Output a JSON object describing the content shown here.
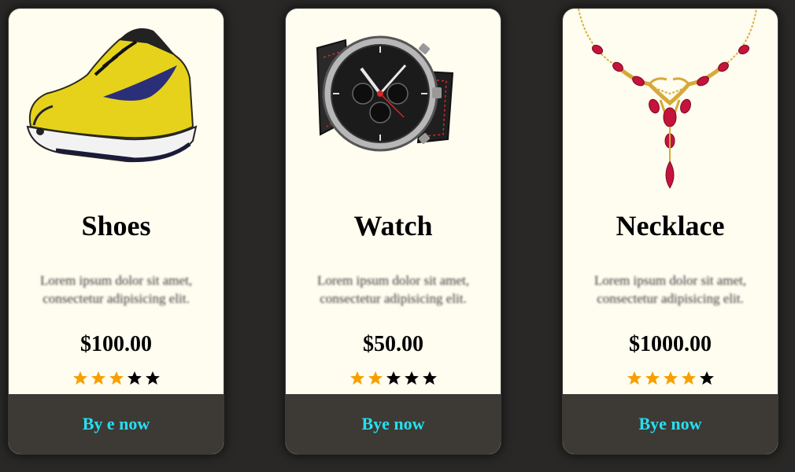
{
  "products": [
    {
      "name": "Shoes",
      "description": "Lorem ipsum dolor sit amet, consectetur adipisicing elit.",
      "price": "$100.00",
      "rating": 3,
      "rating_max": 5,
      "button_label": "By e now",
      "image_icon": "sneaker-image"
    },
    {
      "name": "Watch",
      "description": "Lorem ipsum dolor sit amet, consectetur adipisicing elit.",
      "price": "$50.00",
      "rating": 2,
      "rating_max": 5,
      "button_label": "Bye now",
      "image_icon": "wristwatch-image"
    },
    {
      "name": "Necklace",
      "description": "Lorem ipsum dolor sit amet, consectetur adipisicing elit.",
      "price": "$1000.00",
      "rating": 4,
      "rating_max": 5,
      "button_label": "Bye now",
      "image_icon": "necklace-image"
    }
  ],
  "colors": {
    "page_background": "#292827",
    "card_background": "#fffcf0",
    "button_background": "#3d3a35",
    "button_text": "#27dff0",
    "star_filled": "#f5a000",
    "star_empty": "#000000"
  }
}
